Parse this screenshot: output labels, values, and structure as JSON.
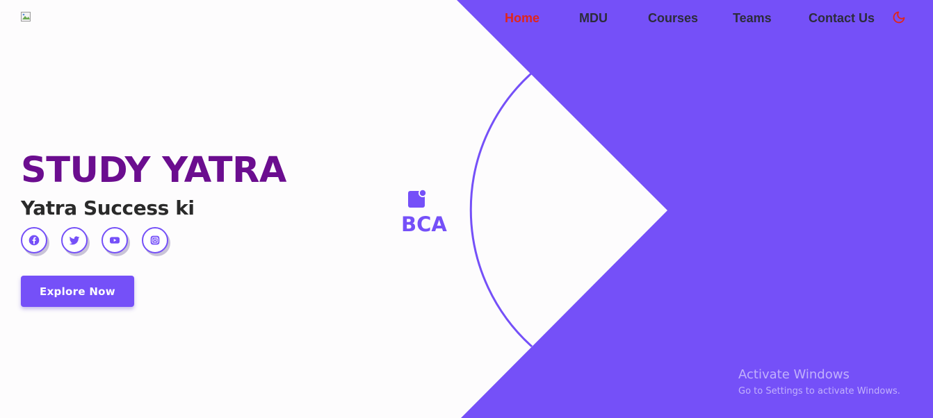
{
  "brand": {
    "logo_icon": "broken-image-icon"
  },
  "nav": {
    "items": [
      {
        "label": "Home",
        "active": true
      },
      {
        "label": "MDU",
        "active": false
      },
      {
        "label": "Courses",
        "active": false
      },
      {
        "label": "Teams",
        "active": false
      },
      {
        "label": "Contact Us",
        "active": false
      }
    ],
    "theme_toggle_icon": "moon-icon"
  },
  "hero": {
    "title": "STUDY YATRA",
    "subtitle": "Yatra Success ki",
    "social_icons": [
      "facebook-icon",
      "twitter-icon",
      "youtube-icon",
      "instagram-icon"
    ],
    "cta_label": "Explore Now"
  },
  "feature": {
    "icon": "notification-square-icon",
    "label": "BCA"
  },
  "watermark": {
    "title": "Activate Windows",
    "subtitle": "Go to Settings to activate Windows."
  },
  "colors": {
    "accent": "#7550f8",
    "title": "#6b0d8f",
    "active_nav": "#e1251b",
    "nav_text": "#2c2c3a",
    "background": "#fdfcfd"
  }
}
